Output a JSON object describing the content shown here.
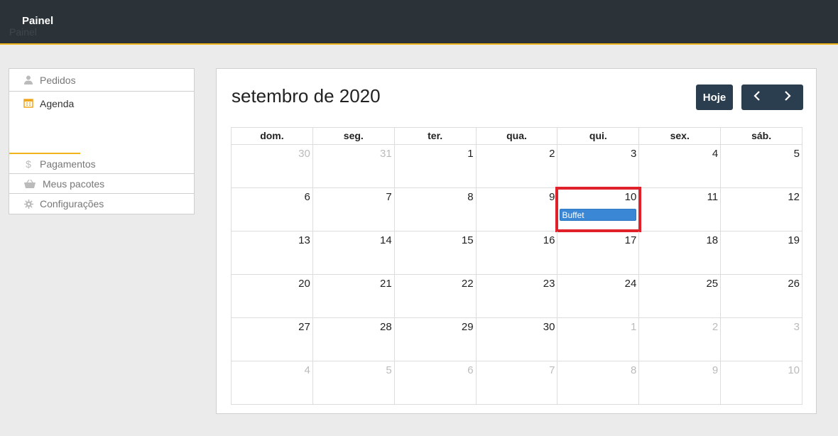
{
  "header": {
    "brand": "Painel",
    "brand_shadow": "Painel"
  },
  "sidebar": {
    "items": [
      {
        "label": "Pedidos",
        "icon": "user-icon"
      },
      {
        "label": "Agenda",
        "icon": "calendar-icon",
        "active": true
      },
      {
        "label": "Pagamentos",
        "icon": "dollar-icon"
      },
      {
        "label": "Meus pacotes",
        "icon": "basket-icon"
      },
      {
        "label": "Configurações",
        "icon": "gear-icon"
      }
    ]
  },
  "calendar": {
    "title": "setembro de 2020",
    "today_label": "Hoje",
    "weekdays": [
      "dom.",
      "seg.",
      "ter.",
      "qua.",
      "qui.",
      "sex.",
      "sáb."
    ],
    "weeks": [
      [
        "30",
        "31",
        "1",
        "2",
        "3",
        "4",
        "5"
      ],
      [
        "6",
        "7",
        "8",
        "9",
        "10",
        "11",
        "12"
      ],
      [
        "13",
        "14",
        "15",
        "16",
        "17",
        "18",
        "19"
      ],
      [
        "20",
        "21",
        "22",
        "23",
        "24",
        "25",
        "26"
      ],
      [
        "27",
        "28",
        "29",
        "30",
        "1",
        "2",
        "3"
      ],
      [
        "4",
        "5",
        "6",
        "7",
        "8",
        "9",
        "10"
      ]
    ],
    "other_month": [
      [
        true,
        true,
        false,
        false,
        false,
        false,
        false
      ],
      [
        false,
        false,
        false,
        false,
        false,
        false,
        false
      ],
      [
        false,
        false,
        false,
        false,
        false,
        false,
        false
      ],
      [
        false,
        false,
        false,
        false,
        false,
        false,
        false
      ],
      [
        false,
        false,
        false,
        false,
        true,
        true,
        true
      ],
      [
        true,
        true,
        true,
        true,
        true,
        true,
        true
      ]
    ],
    "event": {
      "label": "Buffet",
      "week": 1,
      "day": 4,
      "color": "#3a87d6"
    },
    "highlight_color": "#e0212a"
  },
  "colors": {
    "topbar": "#2b3338",
    "accent": "#f0b41c",
    "button": "#2b3e50"
  }
}
